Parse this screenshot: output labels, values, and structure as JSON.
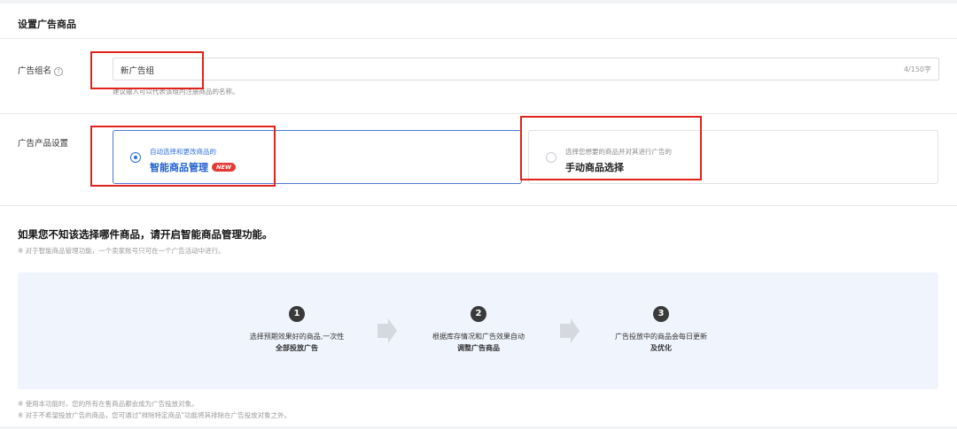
{
  "section_title": "设置广告商品",
  "ad_group": {
    "label": "广告组名",
    "help_icon": "?",
    "value": "新广告组",
    "counter": "4/150字",
    "hint": "建议输入可以代表该组内注册商品的名称。"
  },
  "product_setting": {
    "label": "广告产品设置",
    "options": [
      {
        "subtitle": "自动选择和更改商品的",
        "title": "智能商品管理",
        "badge": "NEW",
        "selected": true
      },
      {
        "subtitle": "选择您想要的商品并对其进行广告的",
        "title": "手动商品选择",
        "selected": false
      }
    ]
  },
  "promo": {
    "headline": "如果您不知该选择哪件商品，请开启智能商品管理功能。",
    "note": "※ 对于智能商品管理功能，一个卖家账号只可在一个广告活动中进行。",
    "steps": [
      {
        "num": "1",
        "line1": "选择预期效果好的商品,一次性",
        "line2": "全部投放广告"
      },
      {
        "num": "2",
        "line1": "根据库存情况和广告效果自动",
        "line2": "调整广告商品"
      },
      {
        "num": "3",
        "line1": "广告投放中的商品会每日更新",
        "line2": "及优化"
      }
    ],
    "footnotes": [
      "※ 使用本功能时，您的所有在售商品都会成为广告投放对象。",
      "※ 对于不希望投放广告的商品，您可通过\"排除特定商品\"功能将其排除在广告投放对象之外。"
    ]
  },
  "colors": {
    "accent": "#2f6fde",
    "highlight_box": "#e2231a",
    "badge": "#e53935",
    "steps_bg": "#f0f4fd"
  }
}
